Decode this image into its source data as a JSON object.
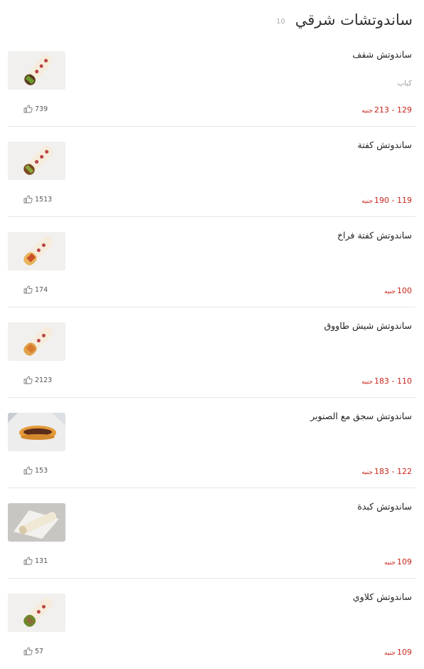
{
  "header": {
    "title": "ساندوتشات شرقي",
    "count": "10"
  },
  "currency": "جنيه",
  "items": [
    {
      "name": "ساندوتش شقف",
      "category": "كباب",
      "price": "129 - 213",
      "likes": "739",
      "image": "wrap-sandwich-icon"
    },
    {
      "name": "ساندوتش كفتة",
      "category": "",
      "price": "119 - 190",
      "likes": "1513",
      "image": "wrap-sandwich-icon"
    },
    {
      "name": "ساندوتش كفتة فراخ",
      "category": "",
      "price": "100",
      "likes": "174",
      "image": "wrap-sandwich-icon"
    },
    {
      "name": "ساندوتش شيش طاووق",
      "category": "",
      "price": "110 - 183",
      "likes": "2123",
      "image": "wrap-sandwich-icon"
    },
    {
      "name": "ساندوتش سجق مع الصنوبر",
      "category": "",
      "price": "122 - 183",
      "likes": "153",
      "image": "sausage-sandwich-icon"
    },
    {
      "name": "ساندوتش كبدة",
      "category": "",
      "price": "109",
      "likes": "131",
      "image": "rolled-sandwich-icon"
    },
    {
      "name": "ساندوتش كلاوي",
      "category": "",
      "price": "109",
      "likes": "57",
      "image": "wrap-sandwich-icon"
    }
  ],
  "colors": {
    "price": "#c9251a",
    "divider": "#e6e6e6",
    "title": "#333333"
  }
}
